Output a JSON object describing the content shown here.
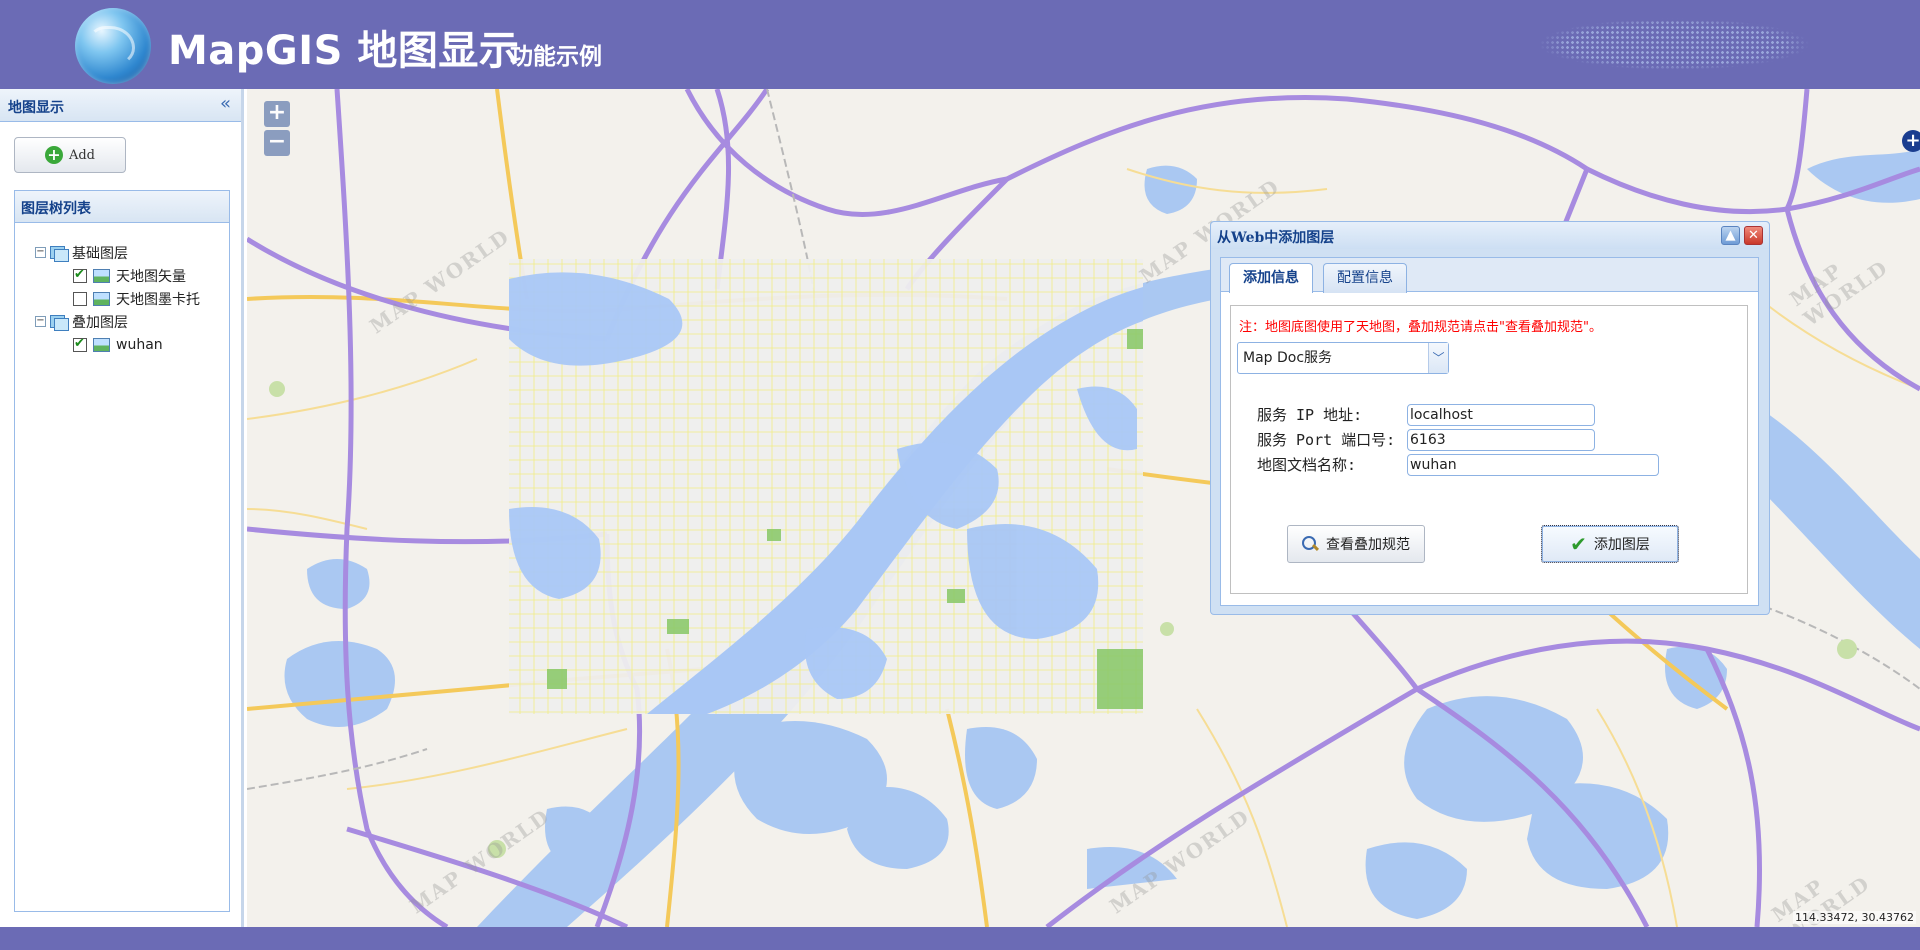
{
  "header": {
    "title": "MapGIS 地图显示",
    "subtitle": "功能示例"
  },
  "left_panel": {
    "title": "地图显示",
    "add_label": "Add",
    "layer_box_title": "图层树列表",
    "tree": [
      {
        "label": "基础图层",
        "type": "group",
        "expanded": true
      },
      {
        "label": "天地图矢量",
        "type": "layer",
        "checked": true
      },
      {
        "label": "天地图墨卡托",
        "type": "layer",
        "checked": false
      },
      {
        "label": "叠加图层",
        "type": "group",
        "expanded": true
      },
      {
        "label": "wuhan",
        "type": "layer",
        "checked": true
      }
    ]
  },
  "map": {
    "zoom_in": "+",
    "zoom_out": "−",
    "coordinates": "114.33472, 30.43762",
    "watermark": "MAP WORLD"
  },
  "dialog": {
    "title": "从Web中添加图层",
    "tabs": [
      {
        "label": "添加信息",
        "active": true
      },
      {
        "label": "配置信息",
        "active": false
      }
    ],
    "note": "注：地图底图使用了天地图，叠加规范请点击\"查看叠加规范\"。",
    "service_type": "Map Doc服务",
    "fields": {
      "ip_label": "服务 IP 地址:",
      "ip_value": "localhost",
      "port_label": "服务 Port 端口号:",
      "port_value": "6163",
      "doc_label": "地图文档名称:",
      "doc_value": "wuhan"
    },
    "view_spec_label": "查看叠加规范",
    "add_layer_label": "添加图层"
  },
  "colors": {
    "header_bg": "#6b6bb5",
    "panel_border": "#99bbe8",
    "note_red": "#ff0000",
    "water": "#aac8f2",
    "highway": "#a78be0",
    "major_road": "#f4c95a"
  }
}
